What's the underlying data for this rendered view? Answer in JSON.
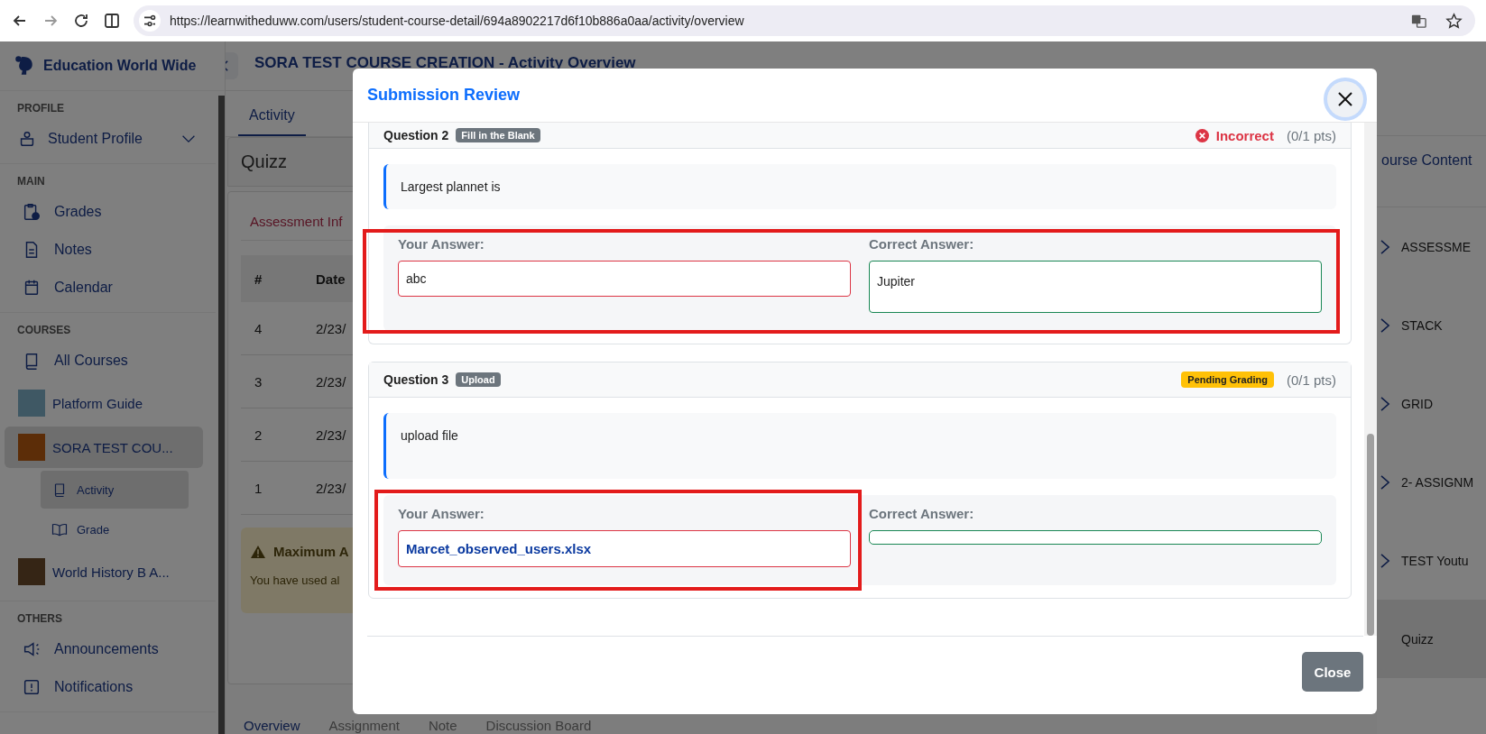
{
  "browser": {
    "url": "https://learnwitheduww.com/users/student-course-detail/694a8902217d6f10b886a0aa/activity/overview"
  },
  "sidebar": {
    "brand": "Education World Wide",
    "sections": [
      {
        "heading": "PROFILE",
        "items": [
          {
            "kind": "profile",
            "label": "Student Profile",
            "expanded": false
          }
        ]
      },
      {
        "heading": "MAIN",
        "items": [
          {
            "kind": "grades",
            "label": "Grades"
          },
          {
            "kind": "notes",
            "label": "Notes"
          },
          {
            "kind": "calendar",
            "label": "Calendar"
          }
        ]
      },
      {
        "heading": "COURSES",
        "items": [
          {
            "kind": "book",
            "label": "All Courses"
          },
          {
            "kind": "course",
            "label": "Platform Guide",
            "selected": false
          },
          {
            "kind": "course",
            "label": "SORA TEST COU...",
            "selected": true,
            "children": [
              {
                "kind": "book",
                "label": "Activity",
                "selected": true
              },
              {
                "kind": "open-book",
                "label": "Grade",
                "selected": false
              }
            ]
          },
          {
            "kind": "course",
            "label": "World History B A...",
            "selected": false
          }
        ]
      },
      {
        "heading": "OTHERS",
        "items": [
          {
            "kind": "megaphone",
            "label": "Announcements"
          },
          {
            "kind": "alert",
            "label": "Notifications"
          }
        ]
      }
    ]
  },
  "main": {
    "title": "SORA TEST COURSE CREATION - Activity Overview",
    "tabs": [
      {
        "label": "Activity",
        "selected": true
      }
    ],
    "section_title": "Quizz",
    "subtab": "Assessment Inf",
    "table": {
      "columns": [
        "#",
        "Date"
      ],
      "rows": [
        [
          "4",
          "2/23/"
        ],
        [
          "3",
          "2/23/"
        ],
        [
          "2",
          "2/23/"
        ],
        [
          "1",
          "2/23/"
        ]
      ]
    },
    "alert": {
      "title": "Maximum A",
      "text": "You have used al"
    },
    "bottom_tabs": [
      {
        "label": "Overview",
        "selected": true
      },
      {
        "label": "Assignment",
        "selected": false
      },
      {
        "label": "Note",
        "selected": false
      },
      {
        "label": "Discussion Board",
        "selected": false
      }
    ]
  },
  "right_panel": {
    "heading": "ourse Content",
    "items": [
      {
        "label": "ASSESSME",
        "selected": false
      },
      {
        "label": "STACK",
        "selected": false
      },
      {
        "label": "GRID",
        "selected": false
      },
      {
        "label": "2- ASSIGNM",
        "selected": false
      },
      {
        "label": "TEST Youtu",
        "selected": false
      },
      {
        "label": "Quizz",
        "selected": true
      }
    ]
  },
  "modal": {
    "title": "Submission Review",
    "close_label": "Close",
    "questions": [
      {
        "label": "Question 2",
        "type": "Fill in the Blank",
        "status": {
          "kind": "incorrect",
          "label": "Incorrect"
        },
        "points": "(0/1 pts)",
        "prompt": "Largest plannet is",
        "your_answer_label": "Your Answer:",
        "your_answer": {
          "kind": "text",
          "value": "abc"
        },
        "correct_answer_label": "Correct Answer:",
        "correct_answer": "Jupiter",
        "highlight_answers": true,
        "highlight_your_answer": false
      },
      {
        "label": "Question 3",
        "type": "Upload",
        "status": {
          "kind": "pending",
          "label": "Pending Grading"
        },
        "points": "(0/1 pts)",
        "prompt": "upload file",
        "your_answer_label": "Your Answer:",
        "your_answer": {
          "kind": "file",
          "value": "Marcet_observed_users.xlsx"
        },
        "correct_answer_label": "Correct Answer:",
        "highlight_answers": false,
        "highlight_your_answer": true
      }
    ]
  }
}
